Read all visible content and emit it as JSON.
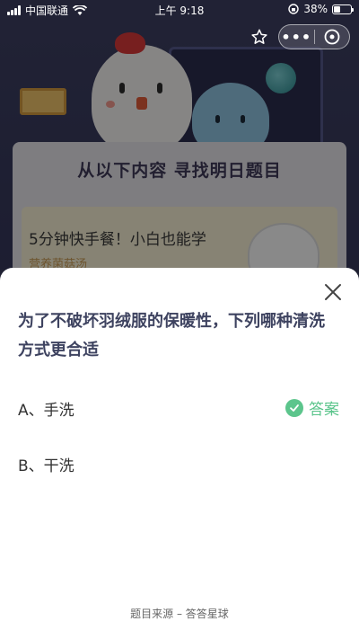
{
  "status_bar": {
    "carrier": "中国联通",
    "time": "上午 9:18",
    "battery": "38%",
    "battery_level": 0.38,
    "icons": [
      "signal-icon",
      "wifi-icon",
      "orientation-lock-icon",
      "battery-icon"
    ]
  },
  "nav": {
    "icons": [
      "star-icon",
      "more-icon",
      "close-circle-icon"
    ],
    "more_label": "•••"
  },
  "banner": {
    "title": "从以下内容  寻找明日题目",
    "card_title": "5分钟快手餐！小白也能学",
    "card_subtitle": "营养菌菇汤"
  },
  "sheet": {
    "question": "为了不破坏羽绒服的保暖性，下列哪种清洗方式更合适",
    "options": [
      {
        "label": "A、手洗",
        "is_answer": true
      },
      {
        "label": "B、干洗",
        "is_answer": false
      }
    ],
    "answer_label": "答案",
    "source": "题目来源 – 答答星球"
  },
  "colors": {
    "answer_green": "#5cc58c",
    "question_text": "#3e4360",
    "overlay": "rgba(0,0,0,0.45)"
  }
}
